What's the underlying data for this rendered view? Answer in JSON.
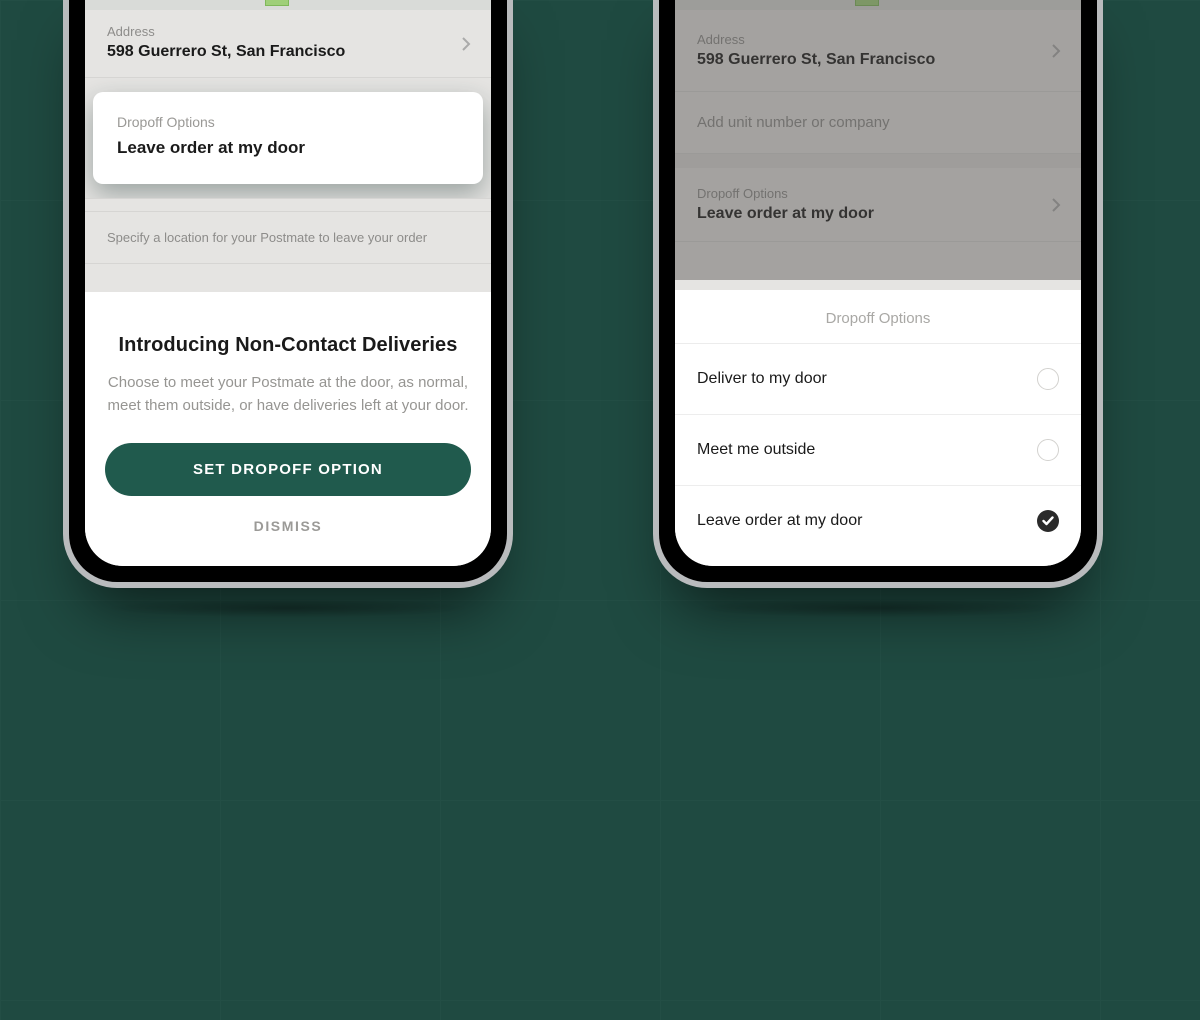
{
  "left": {
    "address": {
      "label": "Address",
      "value": "598 Guerrero St, San Francisco"
    },
    "dropoffCard": {
      "label": "Dropoff Options",
      "value": "Leave order at my door"
    },
    "note": "Specify a location for your Postmate to leave your order",
    "sheet": {
      "title": "Introducing Non-Contact Deliveries",
      "body": "Choose to meet your Postmate at the door, as normal, meet them outside, or have deliveries left at your door.",
      "primary": "SET DROPOFF OPTION",
      "dismiss": "DISMISS"
    }
  },
  "right": {
    "address": {
      "label": "Address",
      "value": "598 Guerrero St, San Francisco"
    },
    "unitPlaceholder": "Add unit number or company",
    "dropoffRow": {
      "label": "Dropoff Options",
      "value": "Leave order at my door"
    },
    "sheet": {
      "title": "Dropoff Options",
      "options": [
        {
          "label": "Deliver to my door",
          "selected": false
        },
        {
          "label": "Meet me outside",
          "selected": false
        },
        {
          "label": "Leave order at my door",
          "selected": true
        }
      ]
    }
  }
}
